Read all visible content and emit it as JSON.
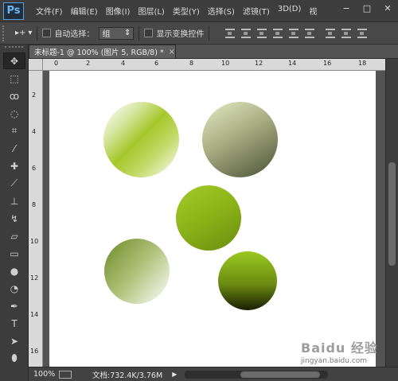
{
  "app": {
    "logo": "Ps"
  },
  "menu": {
    "items": [
      "文件(F)",
      "编辑(E)",
      "图像(I)",
      "图层(L)",
      "类型(Y)",
      "选择(S)",
      "滤镜(T)",
      "3D(D)",
      "视"
    ]
  },
  "window_controls": {
    "minimize": "−",
    "restore": "□",
    "close": "✕"
  },
  "options_bar": {
    "tool_icon": "▸+",
    "tool_dropdown": "▾",
    "auto_select_label": "自动选择：",
    "group_select_value": "组",
    "show_transform_label": "显示变换控件"
  },
  "document": {
    "tab_title": "未标题-1 @ 100% (图片 5, RGB/8) *",
    "tab_close": "×"
  },
  "ruler": {
    "top_labels": [
      "0",
      "2",
      "4",
      "6",
      "8",
      "10",
      "12",
      "14",
      "16",
      "18"
    ],
    "left_labels": [
      "2",
      "4",
      "6",
      "8",
      "10",
      "12",
      "14",
      "16"
    ]
  },
  "status": {
    "zoom": "100%",
    "doc_info": "文档:732.4K/3.76M",
    "arrow": "▶"
  },
  "watermark": {
    "brand": "Baidu 经验",
    "url": "jingyan.baidu.com"
  },
  "colors": {
    "menubar_bg": "#3d3d3d",
    "canvas_bg": "#ffffff",
    "accent_green": "#a4c82a"
  },
  "icons": [
    "move-tool-icon",
    "marquee-tool-icon",
    "lasso-tool-icon",
    "quick-select-tool-icon",
    "crop-tool-icon",
    "eyedropper-tool-icon",
    "healing-brush-tool-icon",
    "brush-tool-icon",
    "clone-stamp-tool-icon",
    "history-brush-tool-icon",
    "eraser-tool-icon",
    "gradient-tool-icon",
    "blur-tool-icon",
    "dodge-tool-icon",
    "pen-tool-icon",
    "type-tool-icon",
    "path-selection-tool-icon",
    "ellipse-tool-icon"
  ]
}
